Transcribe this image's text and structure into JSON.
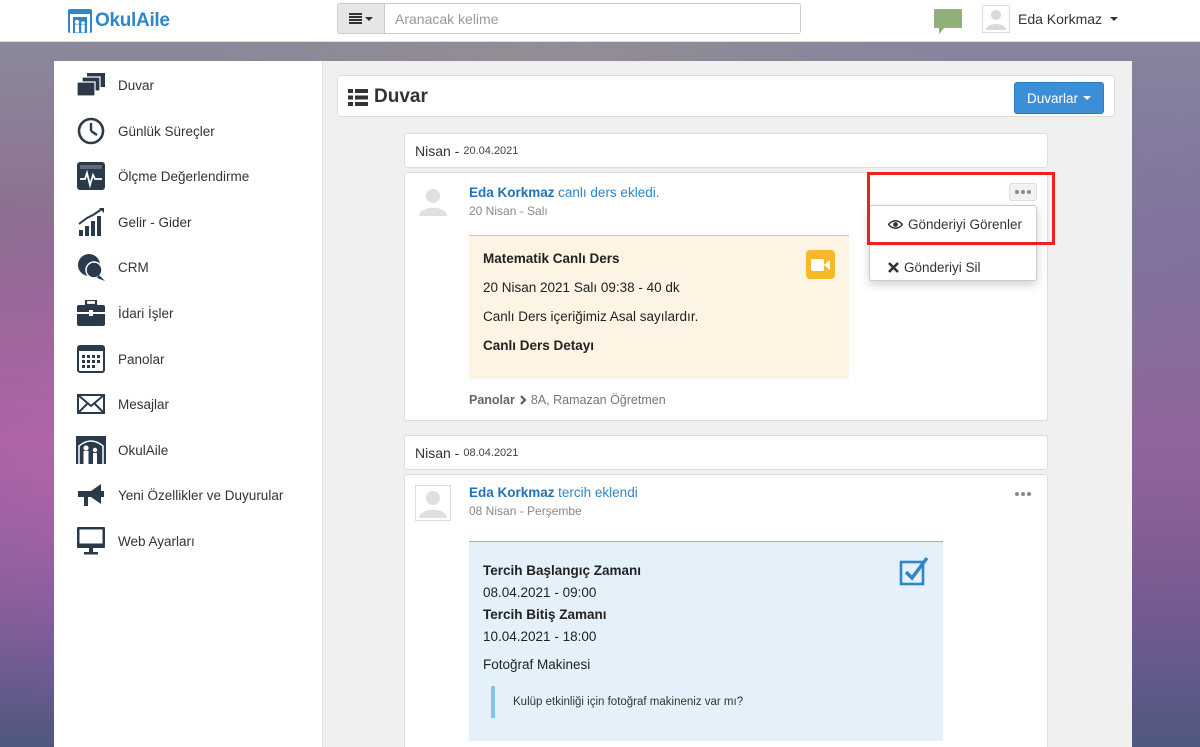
{
  "app": {
    "logo_text": "OkulAile"
  },
  "search": {
    "placeholder": "Aranacak kelime"
  },
  "user": {
    "name": "Eda Korkmaz"
  },
  "sidebar": {
    "items": [
      {
        "label": "Duvar",
        "icon": "wall-icon"
      },
      {
        "label": "Günlük Süreçler",
        "icon": "clock-icon"
      },
      {
        "label": "Ölçme Değerlendirme",
        "icon": "pulse-monitor-icon"
      },
      {
        "label": "Gelir - Gider",
        "icon": "growth-chart-icon"
      },
      {
        "label": "CRM",
        "icon": "chat-bubbles-icon"
      },
      {
        "label": "İdari İşler",
        "icon": "briefcase-icon"
      },
      {
        "label": "Panolar",
        "icon": "board-icon"
      },
      {
        "label": "Mesajlar",
        "icon": "envelope-icon"
      },
      {
        "label": "OkulAile",
        "icon": "family-icon"
      },
      {
        "label": "Yeni Özellikler ve Duyurular",
        "icon": "megaphone-icon"
      },
      {
        "label": "Web Ayarları",
        "icon": "monitor-icon"
      }
    ]
  },
  "header": {
    "title": "Duvar",
    "dropdown_label": "Duvarlar"
  },
  "feed": {
    "groups": [
      {
        "month": "Nisan",
        "date": "20.04.2021",
        "post": {
          "author": "Eda Korkmaz",
          "action": "canlı ders ekledi.",
          "time": "20 Nisan - Salı",
          "live": {
            "title": "Matematik Canlı Ders",
            "datetime": "20 Nisan 2021 Salı 09:38 - 40 dk",
            "content": "Canlı Ders içeriğimiz Asal sayılardır.",
            "detail_label": "Canlı Ders Detayı"
          },
          "breadcrumb": {
            "root": "Panolar",
            "path": "8A, Ramazan Öğretmen"
          }
        }
      },
      {
        "month": "Nisan",
        "date": "08.04.2021",
        "post": {
          "author": "Eda Korkmaz",
          "action": "tercih eklendi",
          "time": "08 Nisan - Perşembe",
          "choice": {
            "start_label": "Tercih Başlangıç Zamanı",
            "start_value": "08.04.2021 - 09:00",
            "end_label": "Tercih Bitiş Zamanı",
            "end_value": "10.04.2021 - 18:00",
            "item": "Fotoğraf Makinesi",
            "question": "Kulüp etkinliği için fotoğraf makineniz var mı?"
          }
        }
      }
    ]
  },
  "post_menu": {
    "items": [
      {
        "label": "Gönderiyi Görenler",
        "icon": "eye-icon"
      },
      {
        "label": "Gönderiyi Sil",
        "icon": "close-icon"
      }
    ]
  },
  "colors": {
    "brand": "#2f86c9",
    "primary_button": "#3c8fd6",
    "live_box_bg": "#fef4e4",
    "choice_box_bg": "#e4f1fb",
    "video_icon": "#f6b92b",
    "highlight": "#f0211d"
  }
}
